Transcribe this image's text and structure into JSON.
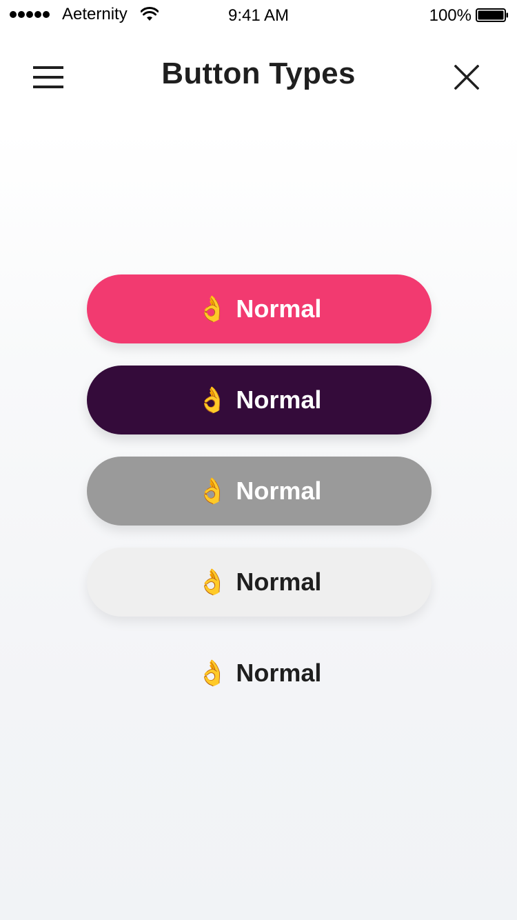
{
  "status_bar": {
    "carrier": "Aeternity",
    "time": "9:41 AM",
    "battery": "100%"
  },
  "nav": {
    "title": "Button Types",
    "left_icon": "menu-icon",
    "right_icon": "close-icon"
  },
  "buttons": [
    {
      "emoji": "👌",
      "label": "Normal",
      "style": "primary",
      "bg": "#f23a70"
    },
    {
      "emoji": "👌",
      "label": "Normal",
      "style": "secondary",
      "bg": "#340b3a"
    },
    {
      "emoji": "👌",
      "label": "Normal",
      "style": "disabled",
      "bg": "#9a9a9a"
    },
    {
      "emoji": "👌",
      "label": "Normal",
      "style": "light",
      "bg": "#efefef"
    },
    {
      "emoji": "👌",
      "label": "Normal",
      "style": "plain",
      "bg": "transparent"
    }
  ]
}
